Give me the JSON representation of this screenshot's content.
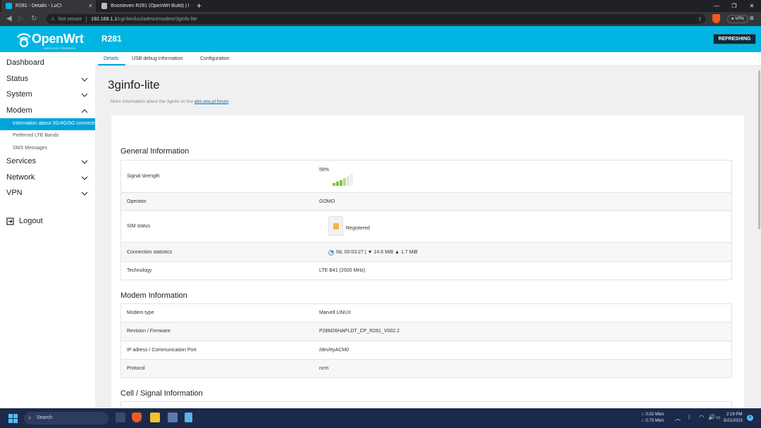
{
  "browser": {
    "tabs": [
      {
        "title": "R281 - Details - LuCI",
        "active": true
      },
      {
        "title": "Boosteven R281 (OpenWrt Build) | Fo...",
        "active": false
      }
    ],
    "new_tab": "+",
    "url_security": "Not secure",
    "url_host": "192.168.1.1",
    "url_path": "/cgi-bin/luci/admin/modem/3ginfo-lite",
    "vpn_label": "VPN"
  },
  "header": {
    "logo_text": "OpenWrt",
    "logo_tagline": "WIRELESS FREEDOM",
    "hostname": "R281",
    "refresh_label": "REFRESHING",
    "accent": "#00b5e2"
  },
  "sidebar": {
    "items": [
      {
        "label": "Dashboard",
        "expandable": false
      },
      {
        "label": "Status",
        "expandable": true
      },
      {
        "label": "System",
        "expandable": true
      },
      {
        "label": "Modem",
        "expandable": true,
        "expanded": true
      },
      {
        "label": "Services",
        "expandable": true
      },
      {
        "label": "Network",
        "expandable": true
      },
      {
        "label": "VPN",
        "expandable": true
      }
    ],
    "modem_sub": [
      {
        "label": "Information about 3G/4G/5G connection",
        "active": true
      },
      {
        "label": "Preferred LTE Bands",
        "active": false
      },
      {
        "label": "SMS Messages",
        "active": false
      }
    ],
    "logout_label": "Logout"
  },
  "content": {
    "tabs": [
      {
        "label": "Details",
        "active": true
      },
      {
        "label": "USB debug information",
        "active": false
      },
      {
        "label": "Configuration",
        "active": false
      }
    ],
    "title": "3ginfo-lite",
    "description_prefix": "More information about the 3ginfo on the ",
    "description_link": "eko.one.pl forum",
    "description_suffix": ".",
    "sections": {
      "general": {
        "title": "General Information",
        "rows": [
          {
            "key": "Signal strength",
            "value": "58%"
          },
          {
            "key": "Operator",
            "value": "GOMO"
          },
          {
            "key": "SIM status",
            "value": "Registered"
          },
          {
            "key": "Connection statistics",
            "value": "0d, 00:03:27 | ▼ 14.6 MiB ▲ 1.7 MiB"
          },
          {
            "key": "Technology",
            "value": "LTE B41 (2500 MHz)"
          }
        ]
      },
      "modem": {
        "title": "Modem Information",
        "rows": [
          {
            "key": "Modem type",
            "value": "Marvell LINUX"
          },
          {
            "key": "Revision / Firmware",
            "value": "P28M26HAPLDT_CP_R281_V002.2"
          },
          {
            "key": "IP adress / Communication Port",
            "value": "/dev/ttyACM0"
          },
          {
            "key": "Protocol",
            "value": "ncm"
          }
        ]
      },
      "cell": {
        "title": "Cell / Signal Information"
      }
    },
    "signal_percent": 58
  },
  "taskbar": {
    "search_label": "Search",
    "net_up": "↑: 0.02 Mb/s",
    "net_down": "↓: 0.73 Mb/s",
    "time": "2:19 PM",
    "date": "5/21/2023",
    "notifications": "5"
  }
}
